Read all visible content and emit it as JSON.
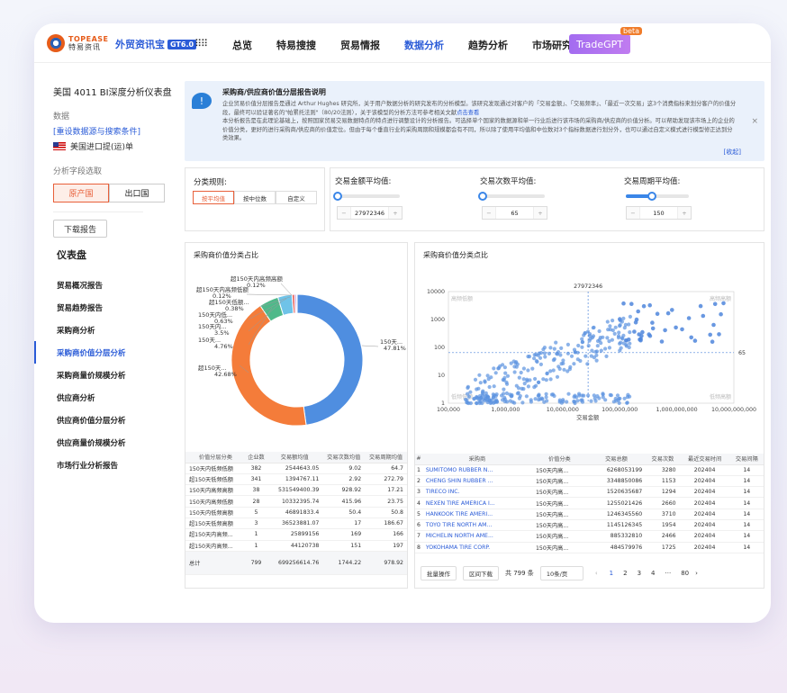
{
  "logo": {
    "en": "TOPEASE",
    "cn": "特易资讯",
    "reg": "®"
  },
  "product": {
    "name": "外贸资讯宝",
    "badge": "GT6.0"
  },
  "nav": [
    "总览",
    "特易搜搜",
    "贸易情报",
    "数据分析",
    "趋势分析",
    "市场研究"
  ],
  "nav_active": "数据分析",
  "tradegpt": {
    "label": "TradeGPT",
    "badge": "beta"
  },
  "sidebar": {
    "title": "美国 4011 BI深度分析仪表盘",
    "data_label": "数据",
    "reset_link": "[重设数据源与搜索条件]",
    "country": "美国进口提(运)单",
    "field_label": "分析字段选取",
    "seg": [
      "原产国",
      "出口国"
    ],
    "download": "下载报告",
    "dashboard": "仪表盘",
    "menu": [
      "贸易概况报告",
      "贸易趋势报告",
      "采购商分析",
      "采购商价值分层分析",
      "采购商量价规模分析",
      "供应商分析",
      "供应商价值分层分析",
      "供应商量价规模分析",
      "市场行业分析报告"
    ],
    "menu_active": "采购商价值分层分析"
  },
  "notice": {
    "title": "采购商/供应商价值分层报告说明",
    "p1": "企业贸易价值分层报告是通过 Arthur Hughes 研究所，关于用户数据分析的研究发布的分析模型。该研究发现通过对客户的「交易金额」、「交易频率」、「最近一次交易」这3个消费指标来划分客户的价值分段，最终可以验证著名的\"帕累托法则\"（80/20法则），关于该模型的分析方法可参考相关文献",
    "p1_link": "点击查看",
    "p2": "本分析报告是在此理论基础上，按照国家贸易交易数据特点的特点进行调整设计的分析报告。可选择单个国家的数据源和单一行业后进行该市场的采购商/供应商的价值分析。可以帮助发现该市场上的企业的价值分类，更好的进行采购商/供应商的价值定位。但由于每个垂直行业的采购周期和规模都会有不同，所以除了使用平均值和中位数对3个指标数据进行划分外，也可以通过自定义模式进行模型修正达到分类效果。",
    "close": "×",
    "fold": "[收起]"
  },
  "rule": {
    "label": "分类规则:",
    "btns": [
      "按平均值",
      "按中位数",
      "自定义"
    ],
    "active": "按平均值"
  },
  "sliders": [
    {
      "label": "交易金额平均值:",
      "value": "27972346",
      "fill": 0.0
    },
    {
      "label": "交易次数平均值:",
      "value": "65",
      "fill": 0.0
    },
    {
      "label": "交易周期平均值:",
      "value": "150",
      "fill": 0.4
    }
  ],
  "pie": {
    "title": "采购商价值分类占比",
    "slices": [
      {
        "name": "150天内高频高额",
        "pct": 0.12,
        "color": "#5aa8e8"
      },
      {
        "name": "超150天高频低额",
        "pct": 0.12,
        "color": "#f4c542"
      },
      {
        "name": "超150天低频高额",
        "pct": 0.38,
        "color": "#9b6ad6"
      },
      {
        "name": "150天内低频高额",
        "pct": 0.63,
        "color": "#e8605a"
      },
      {
        "name": "150天内高频低额",
        "pct": 3.5,
        "color": "#6fc3e8"
      },
      {
        "name": "超150天高频高额",
        "pct": 4.76,
        "color": "#4fb98a"
      },
      {
        "name": "超150天低频低额",
        "pct": 42.68,
        "color": "#f47c3a"
      },
      {
        "name": "150天内低频低额",
        "pct": 47.81,
        "color": "#4f8ee0"
      }
    ],
    "labels": [
      {
        "text": "超150天内高频高额",
        "pct": "0.12%"
      },
      {
        "text": "超150天内高频低额",
        "pct": "0.12%"
      },
      {
        "text": "超150天低额...",
        "pct": "0.38%"
      },
      {
        "text": "150天内低...",
        "pct": "0.63%"
      },
      {
        "text": "150天内...",
        "pct": "3.5%"
      },
      {
        "text": "150天...",
        "pct": "4.76%"
      },
      {
        "text": "超150天...",
        "pct": "42.68%"
      },
      {
        "text": "150天...",
        "pct": "47.81%"
      }
    ]
  },
  "pie_table": {
    "headers": [
      "价值分层分类",
      "企业数",
      "交易额均值",
      "交易次数均值",
      "交易周期均值"
    ],
    "rows": [
      [
        "150天内低频低额",
        "382",
        "2544643.05",
        "9.02",
        "64.7"
      ],
      [
        "超150天低频低额",
        "341",
        "1394767.11",
        "2.92",
        "272.79"
      ],
      [
        "150天内高频高额",
        "38",
        "531549400.39",
        "928.92",
        "17.21"
      ],
      [
        "150天内高频低额",
        "28",
        "10332395.74",
        "415.96",
        "23.75"
      ],
      [
        "150天内低频高额",
        "5",
        "46891833.4",
        "50.4",
        "50.8"
      ],
      [
        "超150天低频高额",
        "3",
        "36523881.07",
        "17",
        "186.67"
      ],
      [
        "超150天内高频...",
        "1",
        "25899156",
        "169",
        "166"
      ],
      [
        "超150天内高频...",
        "1",
        "44120738",
        "151",
        "197"
      ]
    ],
    "total": [
      "总计",
      "799",
      "699256614.76",
      "1744.22",
      "978.92"
    ]
  },
  "scatter": {
    "title": "采购商价值分类点比",
    "xlabel": "交易金额",
    "yticks": [
      "10000",
      "1000",
      "100",
      "10",
      "1"
    ],
    "xticks": [
      "100,000",
      "1,000,000",
      "10,000,000",
      "100,000,000",
      "1,000,000,000",
      "10,000,000,000"
    ],
    "vline_label": "27972346",
    "hline_label": "65",
    "quadrants": [
      "高频低额",
      "高频高额",
      "低频低额",
      "低频高额"
    ]
  },
  "scatter_table": {
    "headers": [
      "#",
      "采购商",
      "价值分类",
      "交易总额",
      "交易次数",
      "最近交易时间",
      "交易间隔"
    ],
    "rows": [
      [
        "1",
        "SUMITOMO RUBBER N...",
        "150天内高...",
        "6268053199",
        "3280",
        "202404",
        "14"
      ],
      [
        "2",
        "CHENG SHIN RUBBER ...",
        "150天内高...",
        "3348850086",
        "1153",
        "202404",
        "14"
      ],
      [
        "3",
        "TIRECO INC.",
        "150天内高...",
        "1520635687",
        "1294",
        "202404",
        "14"
      ],
      [
        "4",
        "NEXEN TIRE AMERICA I...",
        "150天内高...",
        "1255021426",
        "2660",
        "202404",
        "14"
      ],
      [
        "5",
        "HANKOOK TIRE AMERI...",
        "150天内高...",
        "1246345560",
        "3710",
        "202404",
        "14"
      ],
      [
        "6",
        "TOYO TIRE NORTH AM...",
        "150天内高...",
        "1145126345",
        "1954",
        "202404",
        "14"
      ],
      [
        "7",
        "MICHELIN NORTH AME...",
        "150天内高...",
        "885332810",
        "2466",
        "202404",
        "14"
      ],
      [
        "8",
        "YOKOHAMA TIRE CORP.",
        "150天内高...",
        "484579976",
        "1725",
        "202404",
        "14"
      ]
    ]
  },
  "pager": {
    "batch": "批量操作",
    "download": "区间下载",
    "total": "共 799 条",
    "size": "10条/页",
    "pages": [
      "1",
      "2",
      "3",
      "4",
      "···",
      "80"
    ],
    "prev": "‹",
    "next": "›"
  }
}
